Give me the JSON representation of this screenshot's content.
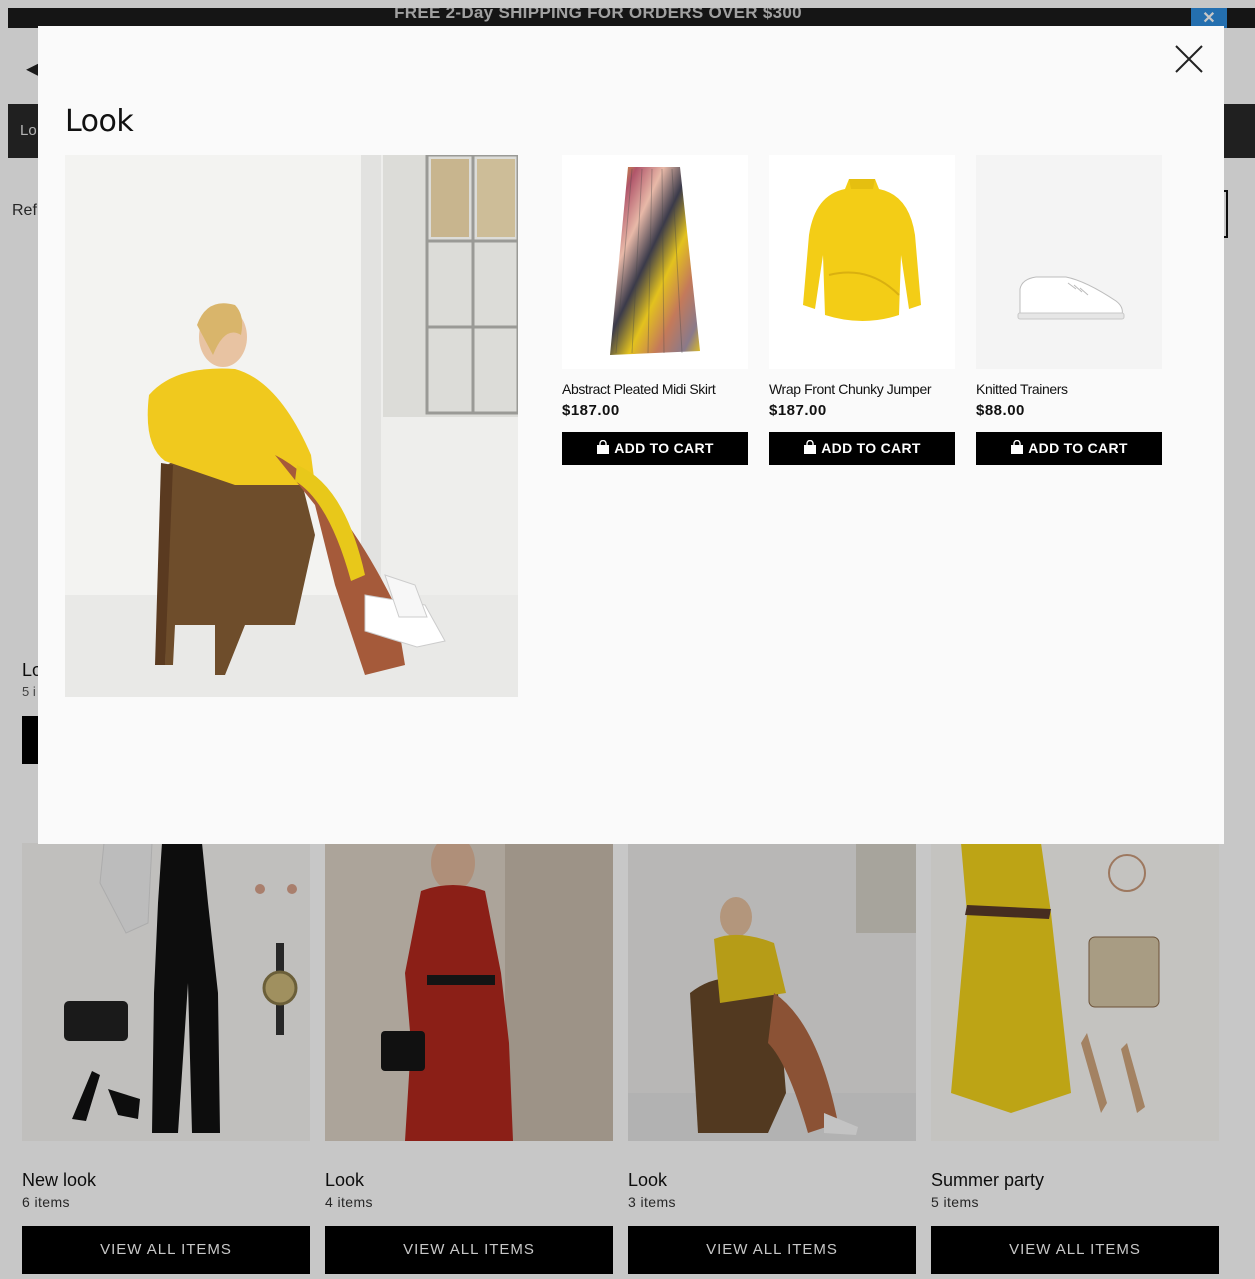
{
  "promo": {
    "text": "FREE 2-Day SHIPPING FOR ORDERS OVER $300",
    "close_icon": "close-icon"
  },
  "background": {
    "nav_label": "Lo",
    "refine_label": "Ref",
    "hidden_look": {
      "name": "Lo",
      "count": "5 i"
    }
  },
  "looks": [
    {
      "name": "New look",
      "count": "6 items",
      "button": "VIEW ALL ITEMS"
    },
    {
      "name": "Look",
      "count": "4 items",
      "button": "VIEW ALL ITEMS"
    },
    {
      "name": "Look",
      "count": "3 items",
      "button": "VIEW ALL ITEMS"
    },
    {
      "name": "Summer party",
      "count": "5 items",
      "button": "VIEW ALL ITEMS"
    }
  ],
  "modal": {
    "title": "Look",
    "close_icon": "close-icon",
    "products": [
      {
        "name": "Abstract Pleated Midi Skirt",
        "price": "$187.00",
        "button": "ADD TO CART",
        "icon": "shopping-bag-icon"
      },
      {
        "name": "Wrap Front Chunky Jumper",
        "price": "$187.00",
        "button": "ADD TO CART",
        "icon": "shopping-bag-icon"
      },
      {
        "name": "Knitted Trainers",
        "price": "$88.00",
        "button": "ADD TO CART",
        "icon": "shopping-bag-icon"
      }
    ]
  },
  "colors": {
    "accent": "#000000",
    "overlay": "#c8c8c8",
    "promo_close": "#2f8fe0",
    "modal_bg": "#fafafa"
  }
}
